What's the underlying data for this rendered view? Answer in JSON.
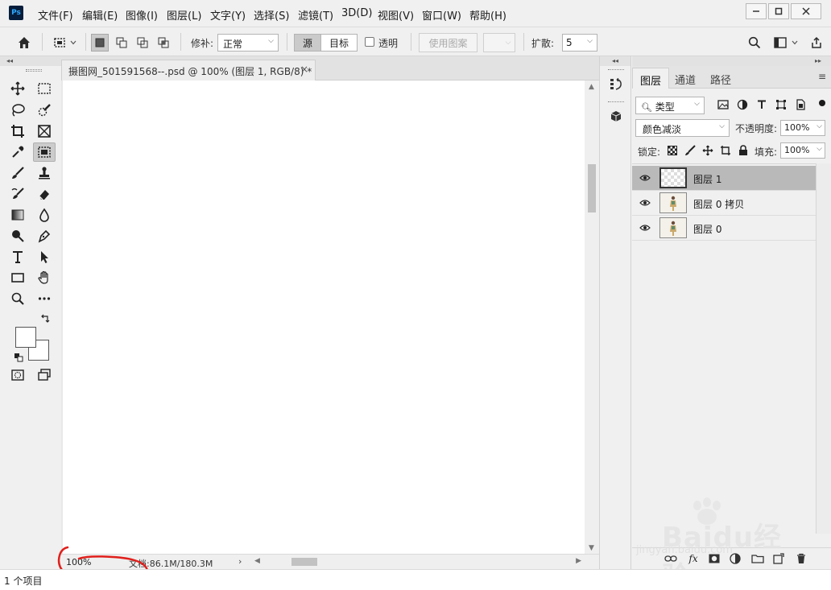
{
  "app": {
    "logo_text": "Ps"
  },
  "menu": [
    "文件(F)",
    "编辑(E)",
    "图像(I)",
    "图层(L)",
    "文字(Y)",
    "选择(S)",
    "滤镜(T)",
    "3D(D)",
    "视图(V)",
    "窗口(W)",
    "帮助(H)"
  ],
  "options": {
    "patch_label": "修补:",
    "patch_mode": "正常",
    "source_label": "源",
    "target_label": "目标",
    "transparent_label": "透明",
    "use_pattern_label": "使用图案",
    "diffusion_label": "扩散:",
    "diffusion_value": "5"
  },
  "document": {
    "tab_title": "摄图网_501591568--.psd @ 100% (图层 1, RGB/8) *",
    "close_glyph": "×",
    "zoom": "100%",
    "doc_info": "文档:86.1M/180.3M"
  },
  "layers_panel": {
    "tabs": [
      "图层",
      "通道",
      "路径"
    ],
    "filter_kind": "类型",
    "blend_mode": "颜色减淡",
    "opacity_label": "不透明度:",
    "opacity_value": "100%",
    "lock_label": "锁定:",
    "fill_label": "填充:",
    "fill_value": "100%",
    "layers": [
      {
        "name": "图层 1",
        "selected": true
      },
      {
        "name": "图层 0 拷贝",
        "selected": false
      },
      {
        "name": "图层 0",
        "selected": false
      }
    ]
  },
  "watermark": {
    "brand": "Baidu经验",
    "sub": "jingyan.baidu.com"
  },
  "os_status": {
    "items_text": "1 个项目"
  },
  "colors": {
    "menu_bg": "#f0f0f0",
    "selected_layer": "#b9b9b9",
    "annotation_red": "#e0201c",
    "ps_blue": "#31a8ff"
  }
}
